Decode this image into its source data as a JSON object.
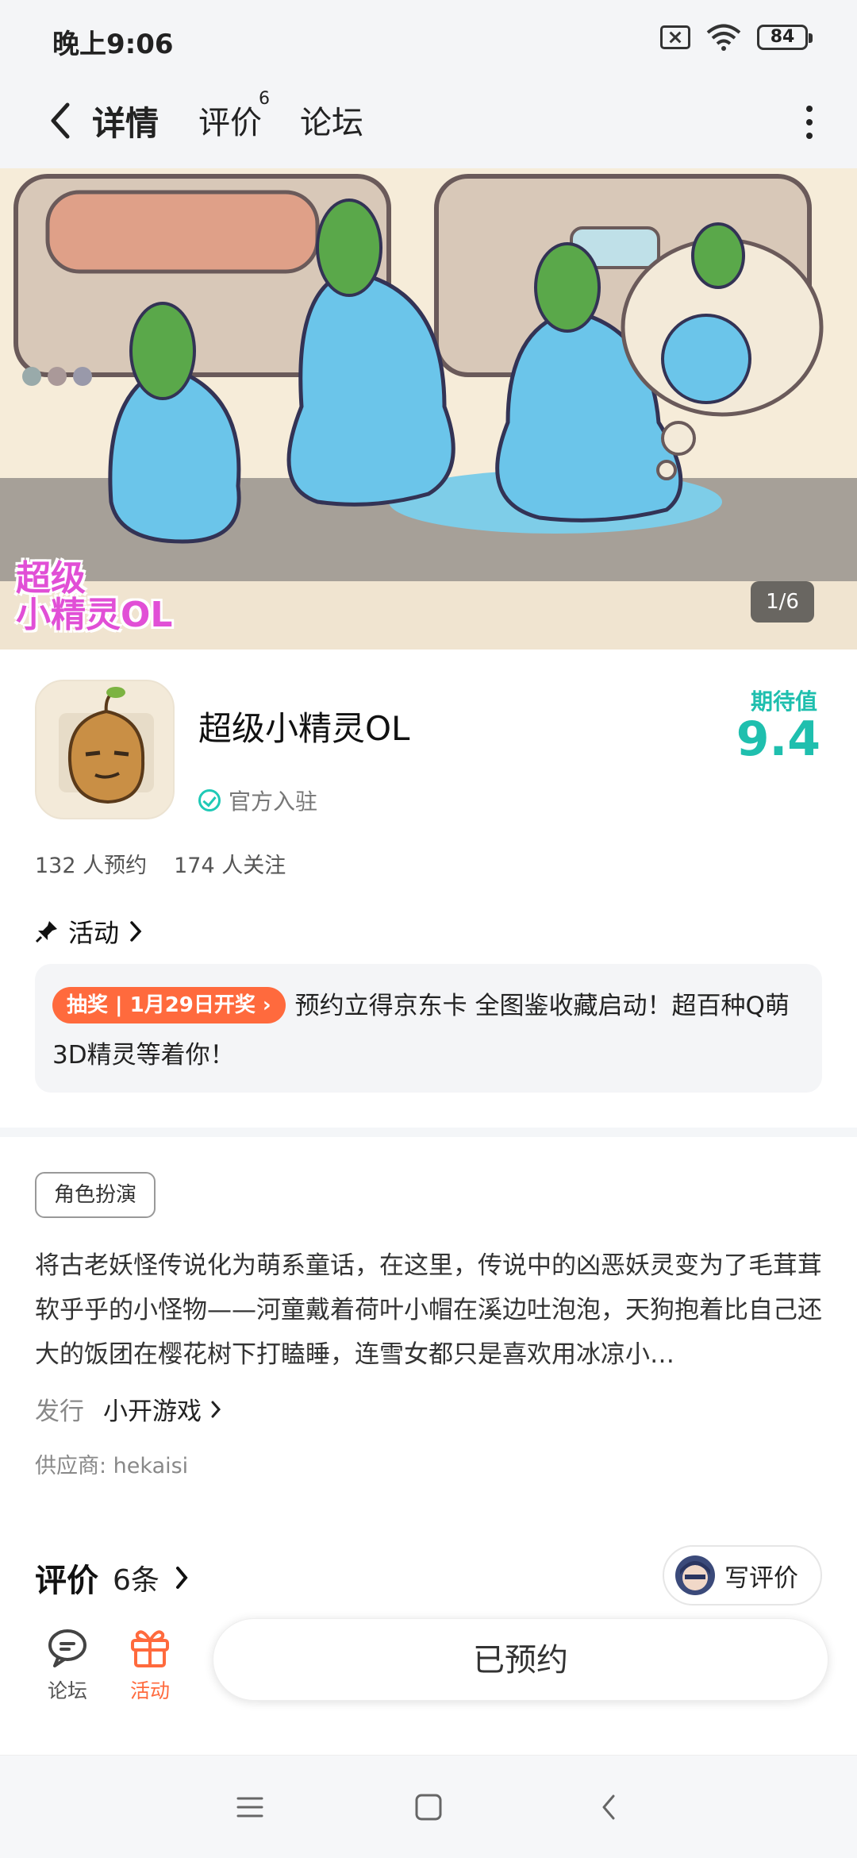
{
  "status": {
    "time": "晚上9:06",
    "battery": "84"
  },
  "nav": {
    "tab_detail": "详情",
    "tab_review": "评价",
    "review_badge": "6",
    "tab_forum": "论坛"
  },
  "banner": {
    "counter": "1/6",
    "logo_line1": "超级",
    "logo_line2": "小精灵OL"
  },
  "app": {
    "name": "超级小精灵OL",
    "official": "官方入驻",
    "expect_label": "期待值",
    "expect_value": "9.4",
    "reservations": "132 人预约",
    "followers": "174 人关注"
  },
  "activity": {
    "title": "活动",
    "tag": "抽奖 | 1月29日开奖",
    "text": "预约立得京东卡 全图鉴收藏启动！超百种Q萌3D精灵等着你！"
  },
  "info": {
    "genre": "角色扮演",
    "description": "将古老妖怪传说化为萌系童话，在这里，传说中的凶恶妖灵变为了毛茸茸软乎乎的小怪物——河童戴着荷叶小帽在溪边吐泡泡，天狗抱着比自己还大的饭团在樱花树下打瞌睡，连雪女都只是喜欢用冰凉小…",
    "publisher_label": "发行",
    "publisher": "小开游戏",
    "supplier": "供应商: hekaisi"
  },
  "reviews": {
    "title": "评价",
    "count": "6条",
    "write": "写评价"
  },
  "bottom": {
    "forum": "论坛",
    "activity": "活动",
    "reserved": "已预约"
  },
  "colors": {
    "accent": "#1fc9b6",
    "orange": "#ff6a3d"
  }
}
